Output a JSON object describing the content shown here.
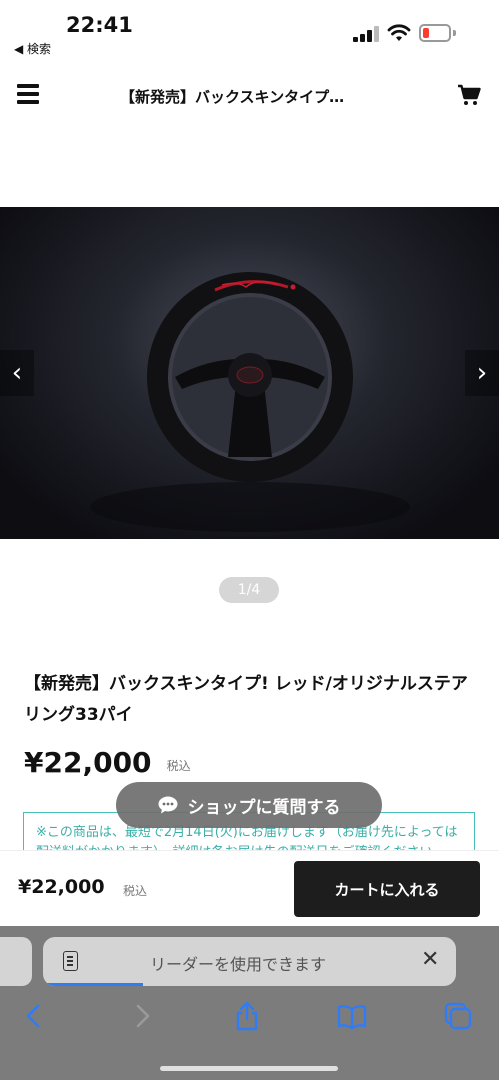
{
  "status": {
    "time": "22:41",
    "back_label": "◀ 検索"
  },
  "header": {
    "title": "【新発売】バックスキンタイプ…"
  },
  "carousel": {
    "indicator": "1/4",
    "prev": "‹",
    "next": "›"
  },
  "product": {
    "title": "【新発売】バックスキンタイプ! レッド/オリジナルステアリング33パイ",
    "price": "¥22,000",
    "tax_label": "税込",
    "delivery_note": "※この商品は、最短で2月14日(火)にお届けします（お届け先によっては配送料がかかります）。詳細は各お届け先の配送日をご確認ください。"
  },
  "chat": {
    "label": "ショップに質問する"
  },
  "purchase_bar": {
    "price": "¥22,000",
    "tax_label": "税込",
    "add_to_cart": "カートに入れる"
  },
  "safari": {
    "reader_text": "リーダーを使用できます",
    "close": "✕"
  },
  "colors": {
    "accent_teal": "#48bfb7",
    "cart_button": "#1d1d1d",
    "safari_blue": "#2f7cf6"
  }
}
